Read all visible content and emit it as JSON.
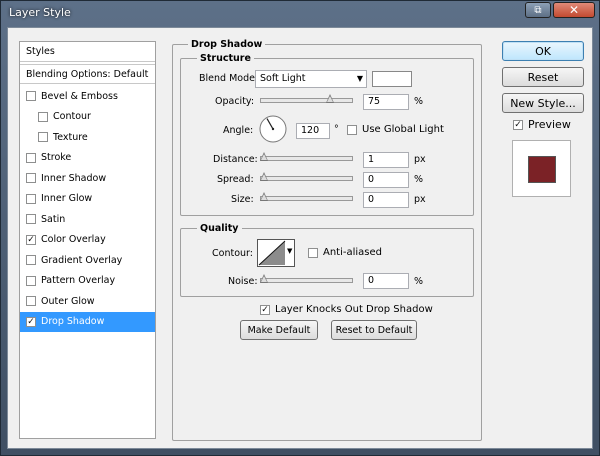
{
  "window": {
    "title": "Layer Style"
  },
  "sidebar": {
    "header": "Styles",
    "blending": "Blending Options: Default",
    "items": [
      {
        "label": "Bevel & Emboss",
        "checked": false,
        "indent": false
      },
      {
        "label": "Contour",
        "checked": false,
        "indent": true
      },
      {
        "label": "Texture",
        "checked": false,
        "indent": true
      },
      {
        "label": "Stroke",
        "checked": false,
        "indent": false
      },
      {
        "label": "Inner Shadow",
        "checked": false,
        "indent": false
      },
      {
        "label": "Inner Glow",
        "checked": false,
        "indent": false
      },
      {
        "label": "Satin",
        "checked": false,
        "indent": false
      },
      {
        "label": "Color Overlay",
        "checked": true,
        "indent": false
      },
      {
        "label": "Gradient Overlay",
        "checked": false,
        "indent": false
      },
      {
        "label": "Pattern Overlay",
        "checked": false,
        "indent": false
      },
      {
        "label": "Outer Glow",
        "checked": false,
        "indent": false
      },
      {
        "label": "Drop Shadow",
        "checked": true,
        "indent": false,
        "selected": true
      }
    ]
  },
  "drop_shadow": {
    "group_title": "Drop Shadow",
    "structure_title": "Structure",
    "blend_mode_label": "Blend Mode:",
    "blend_mode_value": "Soft Light",
    "shadow_color": "#ffffff",
    "opacity_label": "Opacity:",
    "opacity_value": "75",
    "opacity_unit": "%",
    "opacity_level": 0.75,
    "angle_label": "Angle:",
    "angle_value": "120",
    "angle_unit": "°",
    "global_light_label": "Use Global Light",
    "global_light_checked": false,
    "distance_label": "Distance:",
    "distance_value": "1",
    "distance_unit": "px",
    "spread_label": "Spread:",
    "spread_value": "0",
    "spread_unit": "%",
    "size_label": "Size:",
    "size_value": "0",
    "size_unit": "px",
    "quality_title": "Quality",
    "contour_label": "Contour:",
    "anti_aliased_label": "Anti-aliased",
    "noise_label": "Noise:",
    "noise_value": "0",
    "noise_unit": "%",
    "knocks_out_label": "Layer Knocks Out Drop Shadow",
    "knocks_out_checked": true,
    "make_default_label": "Make Default",
    "reset_default_label": "Reset to Default"
  },
  "actions": {
    "ok_label": "OK",
    "reset_label": "Reset",
    "new_style_label": "New Style...",
    "preview_label": "Preview",
    "preview_checked": true,
    "preview_color": "#7b2226"
  }
}
